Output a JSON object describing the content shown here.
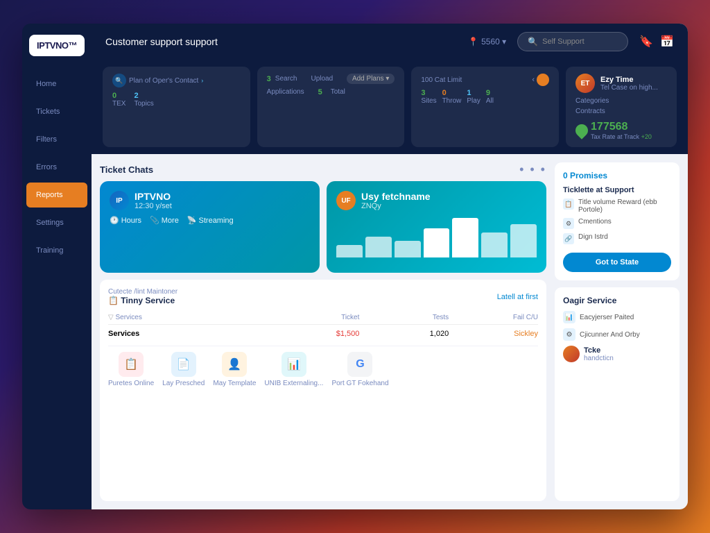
{
  "app": {
    "logo": "IPTVNO™",
    "header": {
      "title": "Customer support support",
      "location": "5560 ▾",
      "search_placeholder": "Self Support"
    }
  },
  "sidebar": {
    "items": [
      {
        "label": "Home",
        "active": false
      },
      {
        "label": "Tickets",
        "active": false
      },
      {
        "label": "Filters",
        "active": false
      },
      {
        "label": "Errors",
        "active": false
      },
      {
        "label": "Reports",
        "active": true
      },
      {
        "label": "Settings",
        "active": false
      },
      {
        "label": "Training",
        "active": false
      }
    ]
  },
  "stats": {
    "card1": {
      "title": "Plan of Oper's Contact",
      "items": [
        {
          "num": "0",
          "label": "TEX"
        },
        {
          "num": "2",
          "label": "Topics"
        }
      ]
    },
    "card2": {
      "dropdown": "Add Plans ▾",
      "items": [
        {
          "num": "3",
          "label": "Search"
        },
        {
          "num": "",
          "label": "Upload"
        },
        {
          "num": "5",
          "label": "Total"
        }
      ],
      "applications": "Applications"
    },
    "card3": {
      "limit": "100 Cat Limit",
      "items": [
        {
          "num": "3",
          "label": "Sites"
        },
        {
          "num": "0",
          "label": "Throw"
        },
        {
          "num": "1",
          "label": "Play"
        },
        {
          "num": "9",
          "label": "All"
        }
      ]
    },
    "card4": {
      "name": "Ezy Time",
      "subtitle": "Tel Case on high...",
      "categories": "Categories",
      "contracts": "Contracts",
      "location_num": "177568",
      "location_sub": "Tax Rate at Track",
      "location_count": "+20"
    }
  },
  "ticket_chats": {
    "section_title": "Ticket Chats",
    "more_btn": "• • •",
    "cards": [
      {
        "name": "IPTVNO",
        "time": "12:30 y/set",
        "actions": [
          "Hours",
          "More",
          "Streaming"
        ]
      },
      {
        "name": "Usy fetchname",
        "subtitle": "ZNQy",
        "bars": [
          30,
          50,
          40,
          70,
          90,
          60,
          80
        ]
      }
    ]
  },
  "service_table": {
    "header": "Cutecte /lint Maintoner",
    "link": "Latell at first",
    "section_label": "Tinny Service",
    "columns": [
      "Services",
      "Ticket",
      "Tests",
      "Fail C/U"
    ],
    "row": {
      "service": "Services",
      "ticket": "$1,500",
      "tests": "1,020",
      "fail": "Sickley"
    },
    "apps": [
      {
        "label": "Puretes Online",
        "color": "#e53935",
        "icon": "📋"
      },
      {
        "label": "Lay Presched",
        "color": "#0288d1",
        "icon": "📄"
      },
      {
        "label": "May Template",
        "color": "#e67e22",
        "icon": "👤"
      },
      {
        "label": "UNIB Externaling...",
        "color": "#0097a7",
        "icon": "📊"
      },
      {
        "label": "Port GT Fokehand",
        "color": "#4caf50",
        "icon": "G"
      }
    ]
  },
  "promo": {
    "title": "0 Promises",
    "subtitle": "Ticklette at Support",
    "items": [
      {
        "icon": "📋",
        "text": "Title volume Reward (ebb Portole)"
      },
      {
        "icon": "⚙",
        "text": "Cmentions"
      },
      {
        "icon": "🔗",
        "text": "Dign Istrd"
      }
    ],
    "button": "Got to State"
  },
  "quick_links": {
    "title": "Oagir Service",
    "items": [
      {
        "icon": "📊",
        "label": "Eacyjerser Paited"
      },
      {
        "icon": "⚙",
        "label": "Cjicunner And Orby"
      }
    ],
    "user": {
      "label": "Tcke",
      "sub": "handcticn"
    }
  }
}
